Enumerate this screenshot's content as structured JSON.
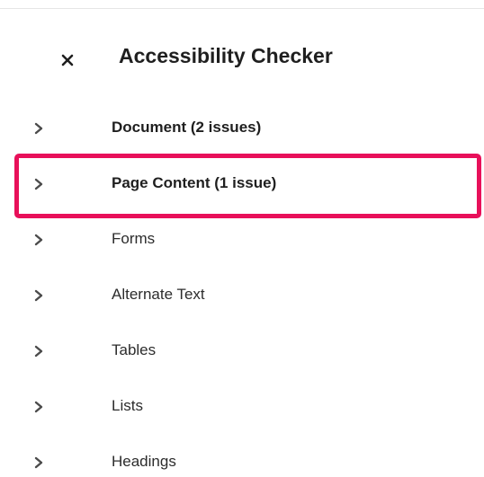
{
  "panel": {
    "title": "Accessibility Checker",
    "close_icon": "close-icon",
    "close_glyph": "×"
  },
  "categories": [
    {
      "label": "Document (2 issues)",
      "has_issues": true
    },
    {
      "label": "Page Content (1 issue)",
      "has_issues": true,
      "highlighted": true
    },
    {
      "label": "Forms",
      "has_issues": false
    },
    {
      "label": "Alternate Text",
      "has_issues": false
    },
    {
      "label": "Tables",
      "has_issues": false
    },
    {
      "label": "Lists",
      "has_issues": false
    },
    {
      "label": "Headings",
      "has_issues": false
    }
  ],
  "colors": {
    "highlight": "#e8105a",
    "text": "#1f1f1f",
    "chevron": "#4b4b4b"
  }
}
